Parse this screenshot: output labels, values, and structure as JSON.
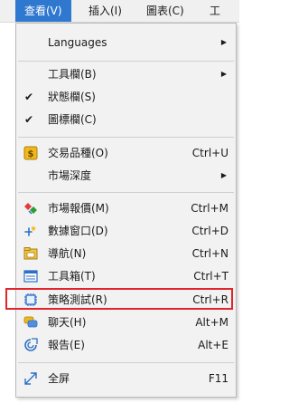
{
  "menubar": {
    "items": [
      "查看(V)",
      "插入(I)",
      "圖表(C)",
      "工"
    ]
  },
  "menu": {
    "items": [
      {
        "label": "Languages",
        "shortcut": "",
        "submenu": true
      },
      {
        "label": "工具欄(B)",
        "shortcut": "",
        "submenu": true
      },
      {
        "label": "狀態欄(S)",
        "shortcut": "",
        "checked": true
      },
      {
        "label": "圖標欄(C)",
        "shortcut": "",
        "checked": true
      },
      {
        "label": "交易品種(O)",
        "shortcut": "Ctrl+U",
        "icon": "symbols-icon"
      },
      {
        "label": "市場深度",
        "shortcut": "",
        "submenu": true
      },
      {
        "label": "市場報價(M)",
        "shortcut": "Ctrl+M",
        "icon": "market-watch-icon"
      },
      {
        "label": "數據窗口(D)",
        "shortcut": "Ctrl+D",
        "icon": "data-window-icon"
      },
      {
        "label": "導航(N)",
        "shortcut": "Ctrl+N",
        "icon": "navigator-icon"
      },
      {
        "label": "工具箱(T)",
        "shortcut": "Ctrl+T",
        "icon": "toolbox-icon"
      },
      {
        "label": "策略測試(R)",
        "shortcut": "Ctrl+R",
        "icon": "strategy-tester-icon"
      },
      {
        "label": "聊天(H)",
        "shortcut": "Alt+M",
        "icon": "chat-icon"
      },
      {
        "label": "報告(E)",
        "shortcut": "Alt+E",
        "icon": "report-icon"
      },
      {
        "label": "全屏",
        "shortcut": "F11",
        "icon": "fullscreen-icon"
      }
    ],
    "submenu_arrow": "▶",
    "check_mark": "✔"
  },
  "colors": {
    "menubar_active": "#2f78d0",
    "highlight_border": "#e0262a"
  }
}
